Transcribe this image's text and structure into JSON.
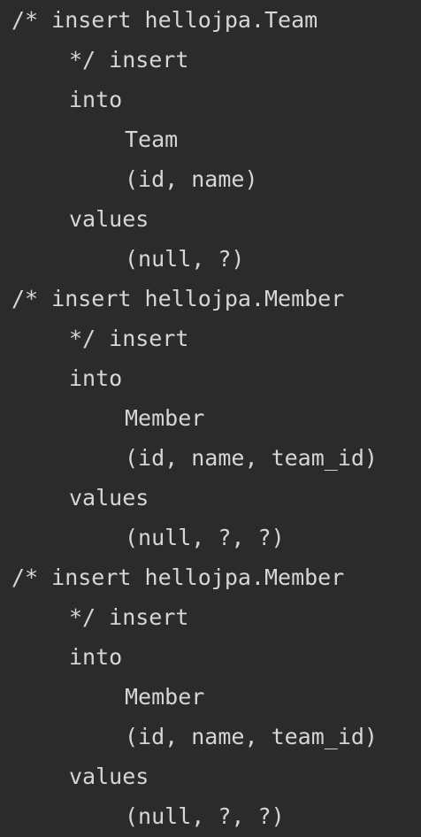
{
  "sql_log": {
    "lines": [
      "/* insert hellojpa.Team",
      "*/ insert",
      "into",
      "Team",
      "(id, name)",
      "values",
      "(null, ?)",
      "/* insert hellojpa.Member",
      "*/ insert",
      "into",
      "Member",
      "(id, name, team_id)",
      "values",
      "(null, ?, ?)",
      "/* insert hellojpa.Member",
      "*/ insert",
      "into",
      "Member",
      "(id, name, team_id)",
      "values",
      "(null, ?, ?)"
    ]
  },
  "colors": {
    "background": "#2b2b2b",
    "text": "#d6d6d6"
  }
}
